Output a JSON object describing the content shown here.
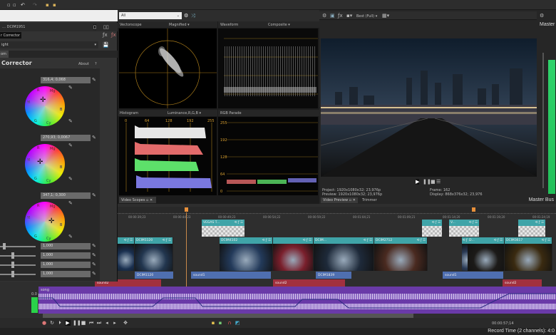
{
  "toolbar": {
    "icons": [
      "new",
      "open",
      "save",
      "undo",
      "redo",
      "render"
    ]
  },
  "color_corrector": {
    "media_name": "DCIM1951",
    "tab_label": "r Corrector",
    "preset": "ight",
    "sub_tab": "om",
    "title": "Corrector",
    "about": "About",
    "help": "?",
    "wheel_values": [
      "316,4; 0,068",
      "270,93; 0,0067",
      "347,1; 0,300"
    ],
    "wheel_labels": {
      "r": "R",
      "mg": "Mg",
      "b": "B",
      "cy": "Cy",
      "g": "G",
      "yl": "Yl"
    },
    "slider_values": [
      "1,000",
      "1,000",
      "1,000",
      "1,000"
    ],
    "slider_levels": [
      0.05,
      0.3,
      0.3,
      0.3
    ]
  },
  "scopes": {
    "source": "All",
    "vectorscope": "Vectorscope",
    "vector_mode": "Magnified",
    "waveform": "Waveform",
    "waveform_mode": "Composite",
    "histogram": "Histogram",
    "histogram_mode": "Luminance,R,G,B",
    "hist_ticks": [
      "0",
      "64",
      "128",
      "192",
      "255"
    ],
    "parade": "RGB Parade",
    "parade_ticks": [
      "255",
      "192",
      "128",
      "64",
      "0"
    ],
    "tab": "Video Scopes"
  },
  "preview": {
    "quality": "Best (Full)",
    "project_label": "Project:",
    "project": "1920x1080x32; 23,976p",
    "preview_label": "Preview:",
    "preview_val": "1920x1080x32; 23,976p",
    "frame_label": "Frame:",
    "frame": "162",
    "display_label": "Display:",
    "display": "868x376x32; 23,976",
    "tab": "Video Preview",
    "tab2": "Trimmer"
  },
  "master": {
    "label": "Master Bus",
    "title": "Master"
  },
  "timeline": {
    "ticks": [
      "00:00:39;23",
      "00:00:44;23",
      "00:00:49;23",
      "00:00:54;22",
      "00:00:59;22",
      "00:01:04;21",
      "00:01:09;21",
      "00:01:14;20",
      "00:01:19;20",
      "00:01:24;19"
    ],
    "overlay_clips": [
      "VEGAS T...",
      "",
      "V...",
      ""
    ],
    "video_clips": [
      "",
      "DCIM1120",
      "DCIM4102",
      "",
      "DCIM...",
      "DCIM2712",
      "",
      "D...",
      "DCIM3617"
    ],
    "audio1_clips": [
      "DCIM1120",
      "sound1",
      "DCIM1839",
      "sound1"
    ],
    "audio2_clips": [
      "sound2",
      "sound2",
      "sound2"
    ],
    "song": "song",
    "track_level": "0.0"
  },
  "status": {
    "time": "00:00:57;14",
    "record": "Record Time (2 channels): 4:0"
  }
}
